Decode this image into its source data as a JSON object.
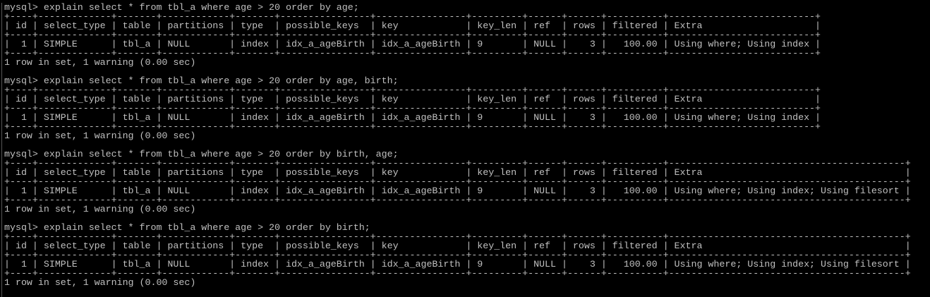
{
  "terminal": {
    "prompt": "mysql> ",
    "columns": [
      "id",
      "select_type",
      "table",
      "partitions",
      "type",
      "possible_keys",
      "key",
      "key_len",
      "ref",
      "rows",
      "filtered",
      "Extra"
    ],
    "right_aligned_columns": [
      "id",
      "rows",
      "filtered"
    ],
    "blocks": [
      {
        "query": "explain select * from tbl_a where age > 20 order by age;",
        "row": [
          "1",
          "SIMPLE",
          "tbl_a",
          "NULL",
          "index",
          "idx_a_ageBirth",
          "idx_a_ageBirth",
          "9",
          "NULL",
          "3",
          "100.00",
          "Using where; Using index"
        ],
        "footer": "1 row in set, 1 warning (0.00 sec)"
      },
      {
        "query": "explain select * from tbl_a where age > 20 order by age, birth;",
        "row": [
          "1",
          "SIMPLE",
          "tbl_a",
          "NULL",
          "index",
          "idx_a_ageBirth",
          "idx_a_ageBirth",
          "9",
          "NULL",
          "3",
          "100.00",
          "Using where; Using index"
        ],
        "footer": "1 row in set, 1 warning (0.00 sec)"
      },
      {
        "query": "explain select * from tbl_a where age > 20 order by birth, age;",
        "row": [
          "1",
          "SIMPLE",
          "tbl_a",
          "NULL",
          "index",
          "idx_a_ageBirth",
          "idx_a_ageBirth",
          "9",
          "NULL",
          "3",
          "100.00",
          "Using where; Using index; Using filesort"
        ],
        "footer": "1 row in set, 1 warning (0.00 sec)"
      },
      {
        "query": "explain select * from tbl_a where age > 20 order by birth;",
        "row": [
          "1",
          "SIMPLE",
          "tbl_a",
          "NULL",
          "index",
          "idx_a_ageBirth",
          "idx_a_ageBirth",
          "9",
          "NULL",
          "3",
          "100.00",
          "Using where; Using index; Using filesort"
        ],
        "footer": "1 row in set, 1 warning (0.00 sec)"
      }
    ]
  },
  "colors": {
    "background": "#000000",
    "text": "#c0c0c0"
  }
}
